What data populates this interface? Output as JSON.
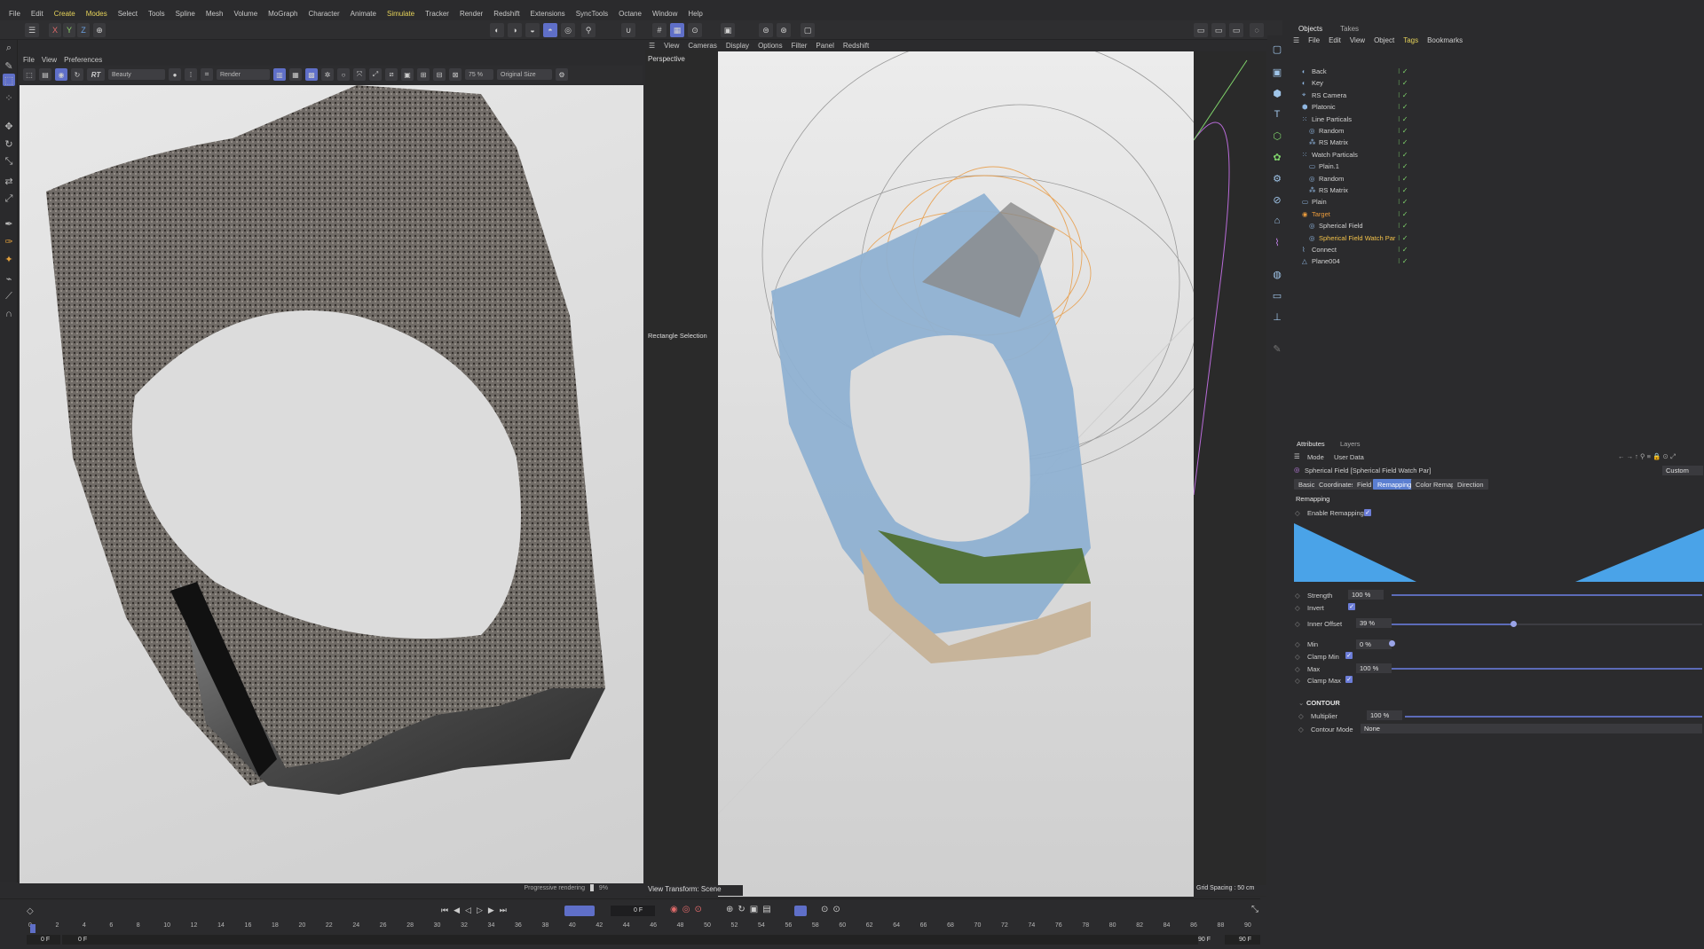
{
  "menubar": [
    "File",
    "Edit",
    "Create",
    "Modes",
    "Select",
    "Tools",
    "Spline",
    "Mesh",
    "Volume",
    "MoGraph",
    "Character",
    "Animate",
    "Simulate",
    "Tracker",
    "Render",
    "Redshift",
    "Extensions",
    "SyncTools",
    "Octane",
    "Window",
    "Help"
  ],
  "render_view": {
    "menu": [
      "File",
      "View",
      "Preferences"
    ],
    "mode_dropdown": "Beauty",
    "render_dropdown": "Render",
    "zoom": "75 %",
    "size_dropdown": "Original Size",
    "status": "Progressive rendering",
    "status_pct": "9%"
  },
  "viewport": {
    "menu": [
      "View",
      "Cameras",
      "Display",
      "Options",
      "Filter",
      "Panel",
      "Redshift"
    ],
    "camera_label": "Perspective",
    "tool_label": "Rectangle Selection",
    "footer_left": "View Transform: Scene",
    "footer_right": "Grid Spacing : 50 cm"
  },
  "objects": {
    "tabs": [
      "Objects",
      "Takes"
    ],
    "menu": [
      "File",
      "Edit",
      "View",
      "Object",
      "Tags",
      "Bookmarks"
    ],
    "rows": [
      {
        "name": "Back",
        "indent": 0,
        "color": "normal"
      },
      {
        "name": "Key",
        "indent": 0,
        "color": "normal"
      },
      {
        "name": "RS Camera",
        "indent": 0,
        "color": "normal"
      },
      {
        "name": "Platonic",
        "indent": 0,
        "color": "normal"
      },
      {
        "name": "Line Particals",
        "indent": 0,
        "color": "normal"
      },
      {
        "name": "Random",
        "indent": 1,
        "color": "normal"
      },
      {
        "name": "RS Matrix",
        "indent": 1,
        "color": "normal"
      },
      {
        "name": "Watch Particals",
        "indent": 0,
        "color": "normal"
      },
      {
        "name": "Plain.1",
        "indent": 1,
        "color": "normal"
      },
      {
        "name": "Random",
        "indent": 1,
        "color": "normal"
      },
      {
        "name": "RS Matrix",
        "indent": 1,
        "color": "normal"
      },
      {
        "name": "Plain",
        "indent": 0,
        "color": "normal"
      },
      {
        "name": "Target",
        "indent": 0,
        "color": "orange"
      },
      {
        "name": "Spherical Field",
        "indent": 1,
        "color": "normal"
      },
      {
        "name": "Spherical Field Watch Par",
        "indent": 1,
        "color": "yellow"
      },
      {
        "name": "Connect",
        "indent": 0,
        "color": "normal"
      },
      {
        "name": "Plane004",
        "indent": 0,
        "color": "normal"
      }
    ]
  },
  "attributes": {
    "tabs": [
      "Attributes",
      "Layers"
    ],
    "mode_menu": [
      "Mode",
      "User Data"
    ],
    "object_title": "Spherical Field [Spherical Field Watch Par]",
    "preset": "Custom",
    "subtabs": [
      "Basic",
      "Coordinates",
      "Field",
      "Remapping",
      "Color Remap",
      "Direction"
    ],
    "selected_subtab": "Remapping",
    "section": "Remapping",
    "enable_remapping": "Enable Remapping",
    "strength_label": "Strength",
    "strength": "100 %",
    "invert_label": "Invert",
    "inner_offset_label": "Inner Offset",
    "inner_offset": "39 %",
    "min_label": "Min",
    "min": "0 %",
    "clamp_min_label": "Clamp Min",
    "max_label": "Max",
    "max": "100 %",
    "clamp_max_label": "Clamp Max",
    "contour_section": "CONTOUR",
    "multiplier_label": "Multiplier",
    "multiplier": "100 %",
    "contour_mode_label": "Contour Mode",
    "contour_mode": "None",
    "accent": "#4aa3e8"
  },
  "timeline": {
    "current_frame": "0 F",
    "start": "0 F",
    "start2": "0 F",
    "end": "90 F",
    "end2": "90 F",
    "ticks": [
      "0",
      "2",
      "4",
      "6",
      "8",
      "10",
      "12",
      "14",
      "16",
      "18",
      "20",
      "22",
      "24",
      "26",
      "28",
      "30",
      "32",
      "34",
      "36",
      "38",
      "40",
      "42",
      "44",
      "46",
      "48",
      "50",
      "52",
      "54",
      "56",
      "58",
      "60",
      "62",
      "64",
      "66",
      "68",
      "70",
      "72",
      "74",
      "76",
      "78",
      "80",
      "82",
      "84",
      "86",
      "88",
      "90"
    ]
  }
}
